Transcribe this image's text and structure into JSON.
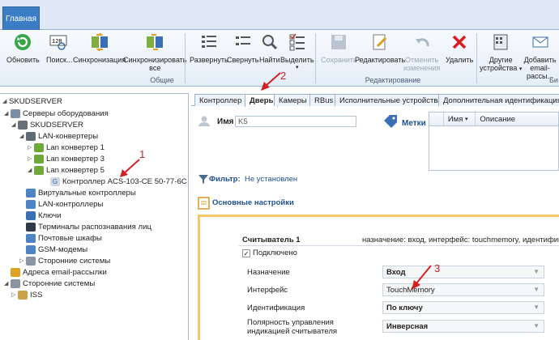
{
  "ribbon": {
    "tab": "Главная",
    "buttons": {
      "refresh": "Обновить",
      "search": "Поиск...",
      "sync": "Синхронизация",
      "sync_selected": [
        "Синхронизировать",
        "все"
      ],
      "expand": "Развернуть",
      "collapse": "Свернуть",
      "find": "Найти",
      "select": "Выделить",
      "save": "Сохранить",
      "edit": "Редактировать",
      "undo": [
        "Отменить",
        "изменения"
      ],
      "delete": "Удалить",
      "other_devices": [
        "Другие",
        "устройства"
      ],
      "add_email": [
        "Добавить",
        "email-рассы..."
      ]
    },
    "groups": {
      "common": "Общие",
      "editing": "Редактирование",
      "cut": "Би"
    }
  },
  "tree": {
    "root": "SKUDSERVER",
    "items": [
      "Серверы оборудования",
      "SKUDSERVER",
      "LAN-конвертеры",
      "Lan конвертер 1",
      "Lan конвертер 3",
      "Lan конвертер 5",
      "Контроллер ACS-103-CE 50-77-6C",
      "Виртуальные контроллеры",
      "LAN-контроллеры",
      "Ключи",
      "Терминалы распознавания лиц",
      "Почтовые шкафы",
      "GSM-модемы",
      "Сторонние системы",
      "Адреса email-рассылки",
      "Сторонние системы",
      "ISS"
    ]
  },
  "tabs": [
    "Контроллер",
    "Дверь",
    "Камеры",
    "RBus",
    "Исполнительные устройства",
    "Дополнительная идентификация"
  ],
  "form": {
    "name_label": "Имя",
    "name_value": "K5",
    "tags_label": "Метки",
    "grid_cols": [
      "Имя",
      "Описание"
    ],
    "filter_label": "Фильтр:",
    "filter_value": "Не установлен",
    "section_title": "Основные настройки",
    "reader_title": "Считыватель 1",
    "reader_desc": "назначение: вход, интерфейс: touchmemory, идентифика",
    "connected": "Подключено",
    "rows": [
      {
        "label": "Назначение",
        "value": "Вход"
      },
      {
        "label": "Интерфейс",
        "value": "TouchMemory"
      },
      {
        "label": "Идентификация",
        "value": "По ключу"
      },
      {
        "label": "Полярность управления\nиндикацией считывателя",
        "value": "Инверсная"
      }
    ]
  },
  "markers": [
    "1",
    "2",
    "3"
  ]
}
